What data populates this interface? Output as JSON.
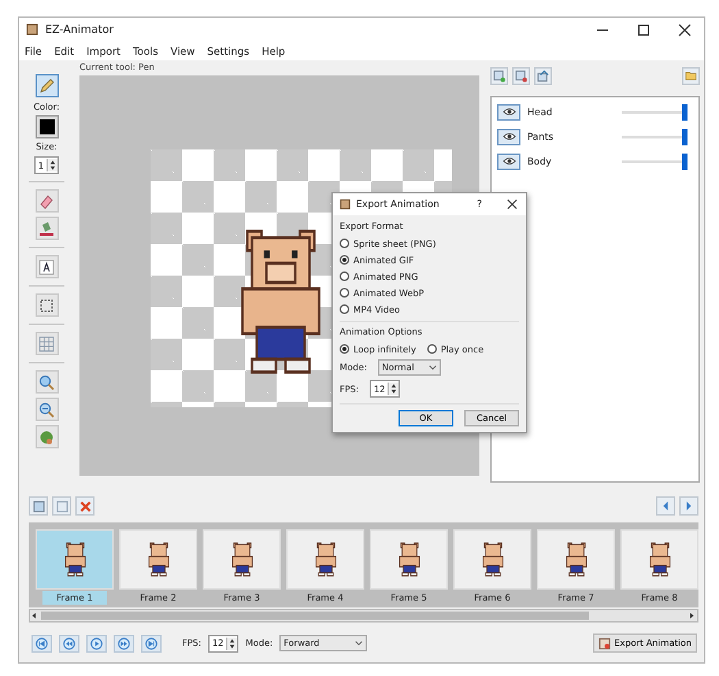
{
  "window": {
    "title": "EZ-Animator"
  },
  "menu": [
    "File",
    "Edit",
    "Import",
    "Tools",
    "View",
    "Settings",
    "Help"
  ],
  "toolbar": {
    "color_label": "Color:",
    "size_label": "Size:",
    "size_value": "1",
    "tools": [
      {
        "kind": "pen",
        "selected": true
      },
      {
        "kind": "eraser",
        "selected": false
      },
      {
        "kind": "fill",
        "selected": false
      },
      {
        "kind": "text",
        "selected": false
      },
      {
        "kind": "select",
        "selected": false
      },
      {
        "kind": "grid",
        "selected": false
      },
      {
        "kind": "zoom-in",
        "selected": false
      },
      {
        "kind": "zoom-out",
        "selected": false
      },
      {
        "kind": "move",
        "selected": false
      }
    ]
  },
  "canvas": {
    "current_tool": "Current tool: Pen"
  },
  "layers": [
    {
      "name": "Head",
      "visible": true,
      "level": 1
    },
    {
      "name": "Pants",
      "visible": true,
      "level": 1
    },
    {
      "name": "Body",
      "visible": true,
      "level": 1
    }
  ],
  "dialog": {
    "title": "Export Animation",
    "help": "?",
    "format_title": "Export Format",
    "formats": [
      {
        "label": "Sprite sheet (PNG)",
        "selected": false
      },
      {
        "label": "Animated GIF",
        "selected": true
      },
      {
        "label": "Animated PNG",
        "selected": false
      },
      {
        "label": "Animated WebP",
        "selected": false
      },
      {
        "label": "MP4 Video",
        "selected": false
      }
    ],
    "options_title": "Animation Options",
    "loop": [
      {
        "label": "Loop infinitely",
        "selected": true
      },
      {
        "label": "Play once",
        "selected": false
      }
    ],
    "mode_label": "Mode:",
    "mode_value": "Normal",
    "fps_label": "FPS:",
    "fps_value": "12",
    "buttons": [
      {
        "label": "OK",
        "default": true
      },
      {
        "label": "Cancel",
        "default": false
      }
    ]
  },
  "frames": [
    {
      "label": "Frame 1",
      "selected": true
    },
    {
      "label": "Frame 2",
      "selected": false
    },
    {
      "label": "Frame 3",
      "selected": false
    },
    {
      "label": "Frame 4",
      "selected": false
    },
    {
      "label": "Frame 5",
      "selected": false
    },
    {
      "label": "Frame 6",
      "selected": false
    },
    {
      "label": "Frame 7",
      "selected": false
    },
    {
      "label": "Frame 8",
      "selected": false
    }
  ],
  "playback": {
    "fps_label": "FPS:",
    "fps_value": "12",
    "mode_label": "Mode:",
    "mode_value": "Forward",
    "export_button": "Export Animation"
  }
}
